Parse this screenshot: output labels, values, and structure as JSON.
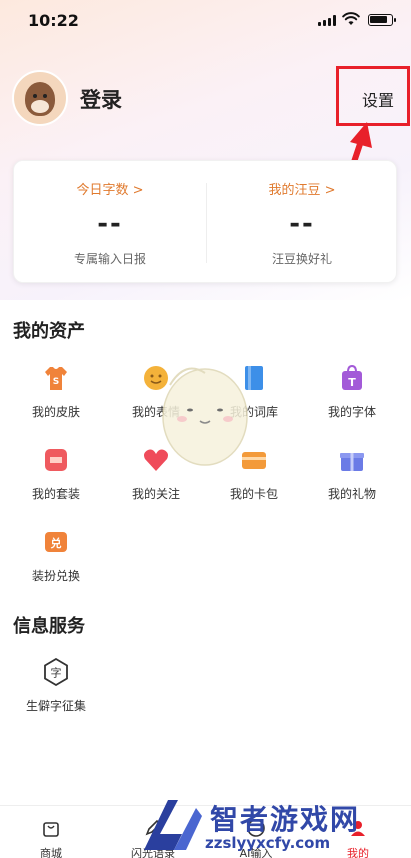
{
  "status_bar": {
    "time": "10:22"
  },
  "header": {
    "login_label": "登录",
    "settings_label": "设置"
  },
  "stats": {
    "left": {
      "title": "今日字数 >",
      "value": "--",
      "subtitle": "专属输入日报"
    },
    "right": {
      "title": "我的汪豆 >",
      "value": "--",
      "subtitle": "汪豆换好礼"
    }
  },
  "assets": {
    "title": "我的资产",
    "items": [
      {
        "label": "我的皮肤",
        "icon": "tshirt-icon",
        "color": "#f0833a"
      },
      {
        "label": "我的表情",
        "icon": "smiley-icon",
        "color": "#f4b23a"
      },
      {
        "label": "我的词库",
        "icon": "book-icon",
        "color": "#3d8fe8"
      },
      {
        "label": "我的字体",
        "icon": "font-bag-icon",
        "color": "#a35ad8"
      },
      {
        "label": "我的套装",
        "icon": "suit-icon",
        "color": "#ef5a5f"
      },
      {
        "label": "我的关注",
        "icon": "heart-icon",
        "color": "#ef4b5a"
      },
      {
        "label": "我的卡包",
        "icon": "card-icon",
        "color": "#f39a3a"
      },
      {
        "label": "我的礼物",
        "icon": "gift-icon",
        "color": "#6b7be6"
      },
      {
        "label": "装扮兑换",
        "icon": "exchange-icon",
        "color": "#f0833a",
        "glyph": "兑"
      }
    ]
  },
  "services": {
    "title": "信息服务",
    "items": [
      {
        "label": "生僻字征集",
        "icon": "rare-char-icon",
        "glyph": "字"
      }
    ]
  },
  "tabbar": {
    "tabs": [
      {
        "label": "商城",
        "icon": "shop-bag-icon"
      },
      {
        "label": "闪光语录",
        "icon": "quote-icon"
      },
      {
        "label": "AI输入",
        "icon": "ai-icon"
      },
      {
        "label": "我的",
        "icon": "profile-icon",
        "active": true
      }
    ]
  },
  "watermark": {
    "brand": "智者游戏网",
    "url": "zzslyyxcfy.com"
  }
}
